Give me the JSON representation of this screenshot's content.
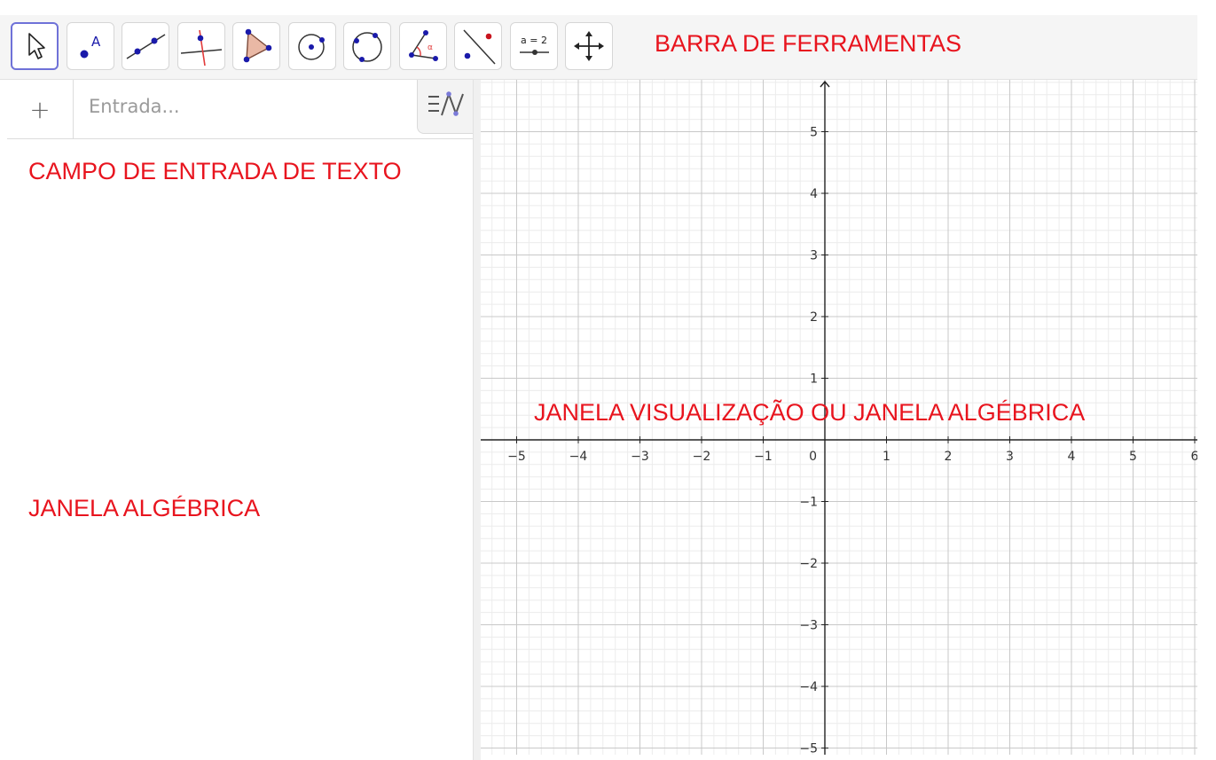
{
  "toolbar": {
    "tools": [
      {
        "name": "move-tool",
        "icon": "pointer-arrow-icon",
        "active": true
      },
      {
        "name": "point-tool",
        "icon": "point-icon"
      },
      {
        "name": "line-tool",
        "icon": "line-through-two-points-icon"
      },
      {
        "name": "perpendicular-line-tool",
        "icon": "perpendicular-line-icon"
      },
      {
        "name": "polygon-tool",
        "icon": "polygon-icon"
      },
      {
        "name": "circle-tool",
        "icon": "circle-center-point-icon"
      },
      {
        "name": "circle-three-points-tool",
        "icon": "circle-three-points-icon"
      },
      {
        "name": "angle-tool",
        "icon": "angle-icon",
        "label": "α"
      },
      {
        "name": "reflect-tool",
        "icon": "reflect-about-line-icon"
      },
      {
        "name": "slider-tool",
        "icon": "slider-icon",
        "label": "a = 2"
      },
      {
        "name": "move-graphics-view-tool",
        "icon": "move-graphics-view-icon"
      }
    ]
  },
  "algebra": {
    "add_symbol": "+",
    "input_placeholder": "Entrada...",
    "style_icon": "algebra-style-icon"
  },
  "annotations": {
    "toolbar": "BARRA DE FERRAMENTAS",
    "input_field": "CAMPO DE ENTRADA DE TEXTO",
    "graphics_view": "JANELA VISUALIZAÇÃO OU JANELA ALGÉBRICA",
    "algebra_view": "JANELA ALGÉBRICA"
  },
  "graphics": {
    "x_ticks": [
      "−5",
      "−4",
      "−3",
      "−2",
      "−1",
      "1",
      "2",
      "3",
      "4",
      "5",
      "6"
    ],
    "y_ticks": [
      "5",
      "4",
      "3",
      "2",
      "1",
      "−1",
      "−2",
      "−3",
      "−4",
      "−5"
    ],
    "origin_label": "0"
  },
  "colors": {
    "accent": "#e8141e",
    "point": "#1a1aaa",
    "active_border": "#6f72d8"
  }
}
